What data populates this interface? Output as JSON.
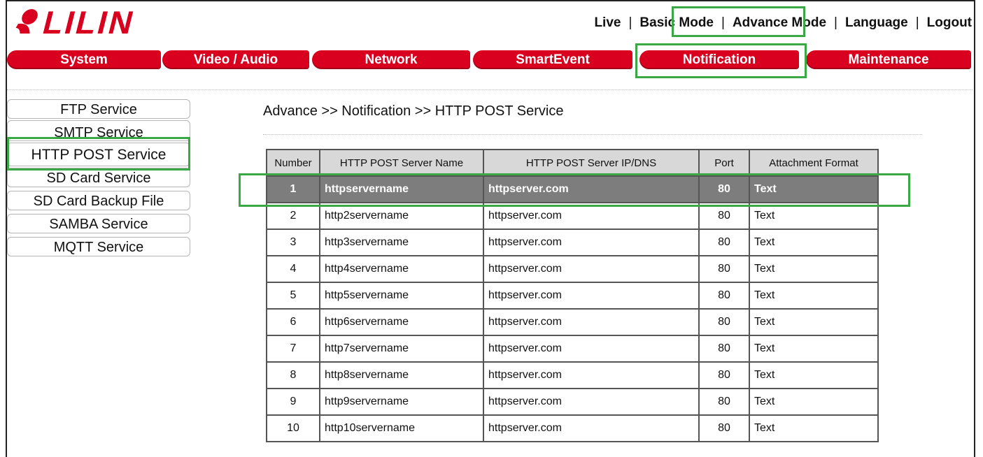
{
  "brand": {
    "logo_text": "LILIN",
    "color": "#d8001e"
  },
  "topnav": {
    "items": [
      "Live",
      "Basic Mode",
      "Advance Mode",
      "Language",
      "Logout"
    ],
    "separator": "|"
  },
  "mainnav": {
    "tabs": [
      "System",
      "Video / Audio",
      "Network",
      "SmartEvent",
      "Notification",
      "Maintenance"
    ],
    "active": "Notification"
  },
  "sidebar": {
    "items": [
      "FTP Service",
      "SMTP Service",
      "HTTP POST Service",
      "SD Card Service",
      "SD Card Backup File",
      "SAMBA Service",
      "MQTT Service"
    ],
    "active": "HTTP POST Service"
  },
  "breadcrumb": "Advance >> Notification >> HTTP POST Service",
  "table": {
    "headers": [
      "Number",
      "HTTP POST Server Name",
      "HTTP POST Server IP/DNS",
      "Port",
      "Attachment Format"
    ],
    "rows": [
      [
        "1",
        "httpservername",
        "httpserver.com",
        "80",
        "Text"
      ],
      [
        "2",
        "http2servername",
        "httpserver.com",
        "80",
        "Text"
      ],
      [
        "3",
        "http3servername",
        "httpserver.com",
        "80",
        "Text"
      ],
      [
        "4",
        "http4servername",
        "httpserver.com",
        "80",
        "Text"
      ],
      [
        "5",
        "http5servername",
        "httpserver.com",
        "80",
        "Text"
      ],
      [
        "6",
        "http6servername",
        "httpserver.com",
        "80",
        "Text"
      ],
      [
        "7",
        "http7servername",
        "httpserver.com",
        "80",
        "Text"
      ],
      [
        "8",
        "http8servername",
        "httpserver.com",
        "80",
        "Text"
      ],
      [
        "9",
        "http9servername",
        "httpserver.com",
        "80",
        "Text"
      ],
      [
        "10",
        "http10servername",
        "httpserver.com",
        "80",
        "Text"
      ]
    ],
    "selected_row": 1
  },
  "colors": {
    "highlight": "#3aa845",
    "tab_red": "#d8001e",
    "selected_row": "#7d7d7d"
  }
}
